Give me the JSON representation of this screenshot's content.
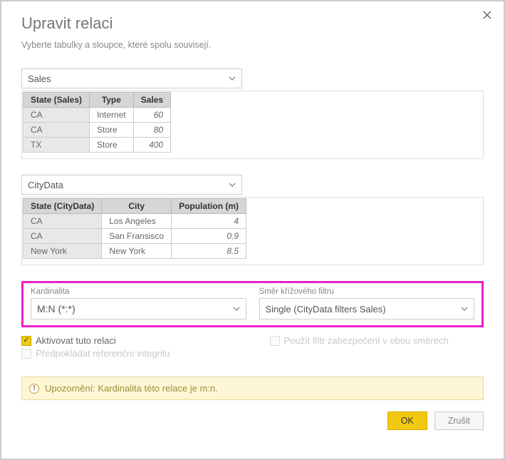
{
  "header": {
    "title": "Upravit relaci",
    "subtitle": "Vyberte tabulky a sloupce, které spolu souvisejí."
  },
  "tableA": {
    "name": "Sales",
    "columns": [
      "State (Sales)",
      "Type",
      "Sales"
    ],
    "rows": [
      {
        "c0": "CA",
        "c1": "Internet",
        "c2": "60"
      },
      {
        "c0": "CA",
        "c1": "Store",
        "c2": "80"
      },
      {
        "c0": "TX",
        "c1": "Store",
        "c2": "400"
      }
    ]
  },
  "tableB": {
    "name": "CityData",
    "columns": [
      "State (CityData)",
      "City",
      "Population (m)"
    ],
    "rows": [
      {
        "c0": "CA",
        "c1": "Los Angeles",
        "c2": "4"
      },
      {
        "c0": "CA",
        "c1": "San Fransisco",
        "c2": "0.9"
      },
      {
        "c0": "New York",
        "c1": "New York",
        "c2": "8.5"
      }
    ]
  },
  "cardinality": {
    "label": "Kardinalita",
    "value": "M:N (*:*)"
  },
  "crossfilter": {
    "label": "Směr křížového filtru",
    "value": "Single (CityData filters Sales)"
  },
  "checks": {
    "activate": "Aktivovat tuto relaci",
    "referential": "Předpokládat referenční integritu",
    "securityBoth": "Použít filtr zabezpečení v obou směrech"
  },
  "warning": {
    "text": "Upozornění: Kardinalita této relace je m:n."
  },
  "footer": {
    "ok": "OK",
    "cancel": "Zrušit"
  }
}
